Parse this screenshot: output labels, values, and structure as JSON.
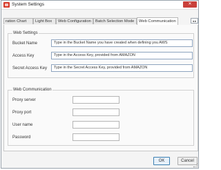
{
  "window": {
    "title": "System Settings",
    "close_glyph": "✕"
  },
  "tabs": [
    {
      "label": "ration Chart"
    },
    {
      "label": "Light Box"
    },
    {
      "label": "Web Configuration"
    },
    {
      "label": "Batch Selection Mode"
    },
    {
      "label": "Web Communication"
    }
  ],
  "tab_scroll": {
    "glyph": "◂ ▸"
  },
  "web_settings": {
    "title": "Web Settings",
    "bucket_name": {
      "label": "Bucket Name",
      "value": "Type in the Bucket Name you have created when defining you AWS"
    },
    "access_key": {
      "label": "Access Key",
      "value": "Type in the Access Key, provided from AMAZON"
    },
    "secret_access_key": {
      "label": "Secret Access Key",
      "value": "Type in the Secret Access Key, provided from AMAZON"
    }
  },
  "web_communication": {
    "title": "Web Communication",
    "proxy_server": {
      "label": "Proxy server",
      "value": ""
    },
    "proxy_port": {
      "label": "Proxy port",
      "value": ""
    },
    "user_name": {
      "label": "User name",
      "value": ""
    },
    "password": {
      "label": "Password",
      "value": ""
    }
  },
  "buttons": {
    "ok": "OK",
    "cancel": "Cancel"
  }
}
